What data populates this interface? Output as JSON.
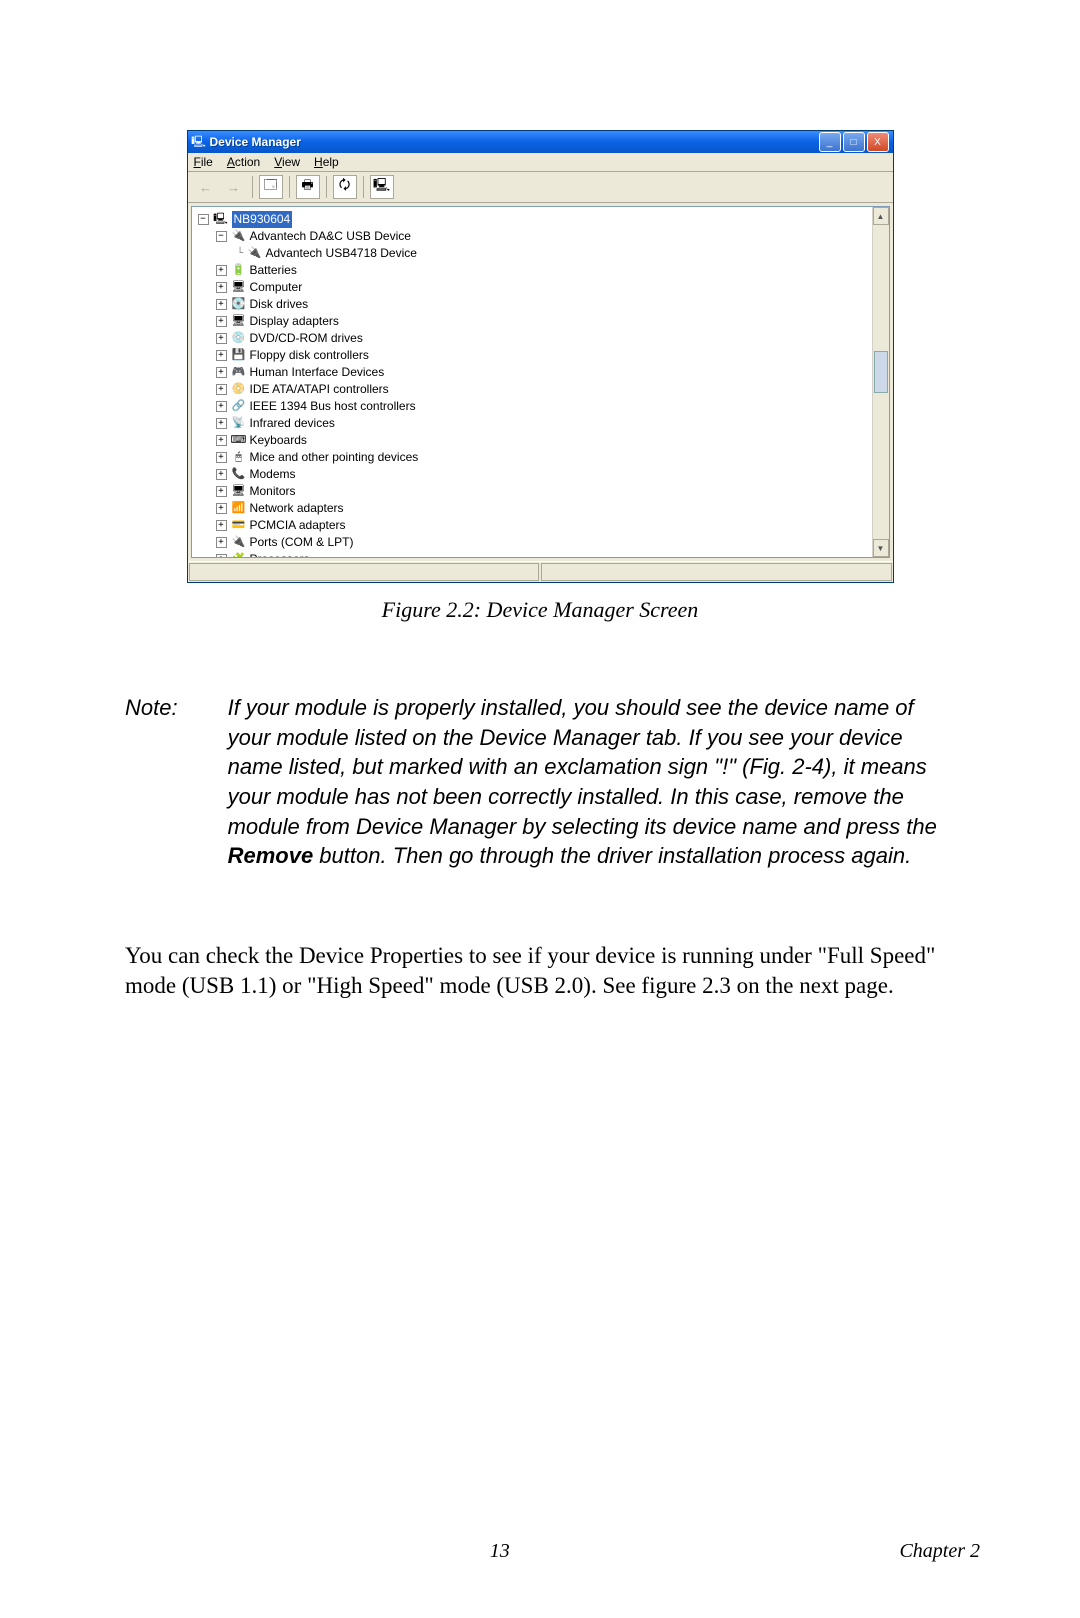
{
  "window": {
    "title": "Device Manager",
    "controls": {
      "min": "_",
      "max": "□",
      "close": "X"
    }
  },
  "menu": {
    "file": "File",
    "action": "Action",
    "view": "View",
    "help": "Help"
  },
  "toolbar": {
    "back": "←",
    "forward": "→",
    "properties": "🗔",
    "print": "🖶",
    "refresh": "🗘",
    "info": "🖳"
  },
  "tree": {
    "root": {
      "label": "NB930604"
    },
    "advantechGroup": {
      "label": "Advantech DA&C USB Device"
    },
    "advantechDevice": {
      "label": "Advantech USB4718 Device"
    },
    "items": [
      "Batteries",
      "Computer",
      "Disk drives",
      "Display adapters",
      "DVD/CD-ROM drives",
      "Floppy disk controllers",
      "Human Interface Devices",
      "IDE ATA/ATAPI controllers",
      "IEEE 1394 Bus host controllers",
      "Infrared devices",
      "Keyboards",
      "Mice and other pointing devices",
      "Modems",
      "Monitors",
      "Network adapters",
      "PCMCIA adapters",
      "Ports (COM & LPT)",
      "Processors"
    ]
  },
  "figure_caption": "Figure 2.2: Device Manager Screen",
  "note": {
    "label": "Note:",
    "body_pre": "If your module is properly installed, you should see the device name of your module listed on the Device Manager tab. If you see your device name listed, but marked with an exclamation sign \"!\" (Fig. 2-4), it means your module has not been correctly installed. In this case, remove the module from Device Manager by selecting its device name and press the ",
    "body_bold": "Remove",
    "body_post": " button. Then go through the driver installation process again."
  },
  "body_para": "You can check the Device Properties  to see if your device is running under \"Full Speed\" mode (USB 1.1) or \"High Speed\" mode (USB 2.0). See figure 2.3 on the next page.",
  "footer": {
    "page": "13",
    "chapter": "Chapter 2"
  }
}
